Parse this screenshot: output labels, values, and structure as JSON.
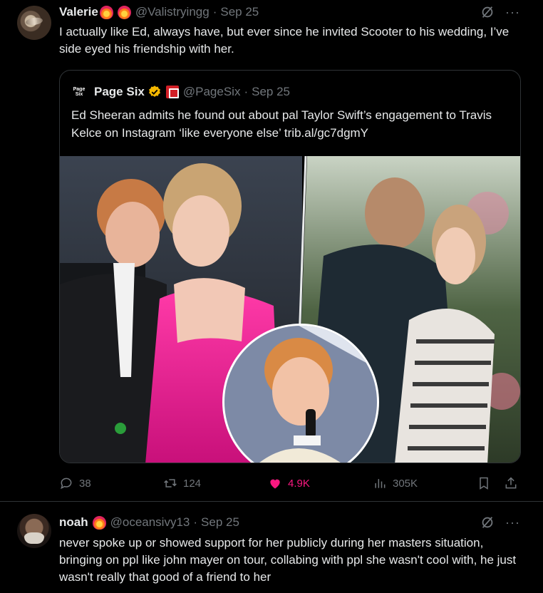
{
  "tweets": [
    {
      "author": {
        "name": "Valerie",
        "badges": [
          "fire-heart-emoji",
          "fire-emoji"
        ],
        "handle": "@Valistryingg"
      },
      "date": "Sep 25",
      "text": "I actually like Ed, always have, but ever since he invited Scooter to his wedding, I’ve side eyed his friendship with her.",
      "quote": {
        "logo_text": [
          "Page",
          "Six"
        ],
        "author": {
          "name": "Page Six",
          "verified": true,
          "handle": "@PageSix"
        },
        "date": "Sep 25",
        "text": "Ed Sheeran admits he found out about pal Taylor Swift’s engagement to Travis Kelce on Instagram ‘like everyone else’ trib.al/gc7dgmY",
        "media": {
          "type": "photo-collage",
          "description_icons": [
            "photo-left",
            "photo-right",
            "inset-circle"
          ]
        }
      },
      "stats": {
        "replies": "38",
        "reposts": "124",
        "likes": "4.9K",
        "views": "305K"
      },
      "colors": {
        "like_active": "#f91880"
      }
    },
    {
      "author": {
        "name": "noah",
        "badges": [
          "fire-heart-emoji"
        ],
        "handle": "@oceansivy13"
      },
      "date": "Sep 25",
      "text": "never spoke up or showed support for her publicly during her masters situation, bringing on ppl like john mayer on tour, collabing with ppl she wasn't cool with, he just wasn't really that good of a friend to her"
    }
  ],
  "ui": {
    "separator": "·",
    "more": "···"
  },
  "colors": {
    "background": "#000000",
    "text": "#e7e9ea",
    "muted": "#71767b",
    "border": "#2f3336",
    "verified": "#f5b800"
  }
}
